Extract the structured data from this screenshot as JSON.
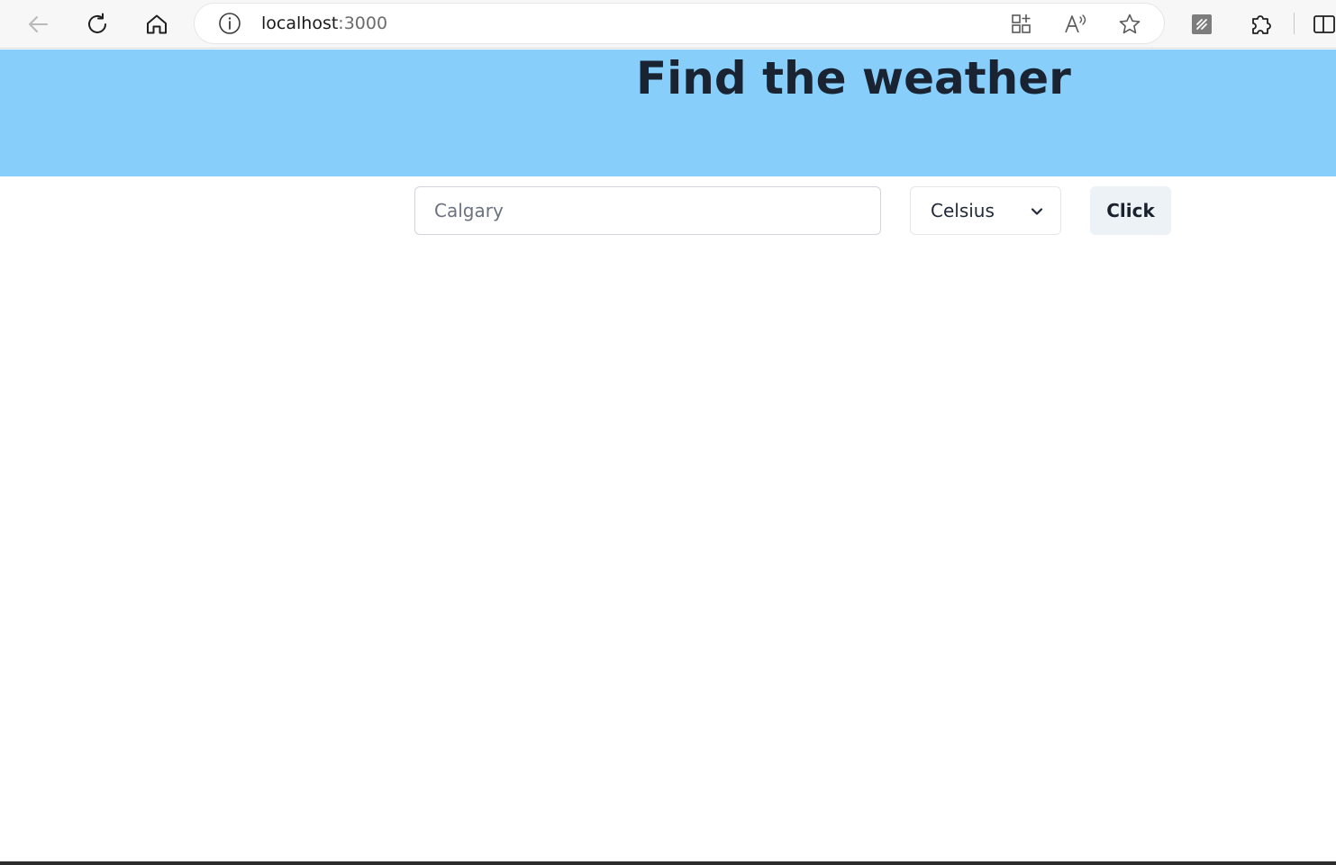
{
  "browser": {
    "url_host": "localhost",
    "url_port": ":3000",
    "toolbar_icons": {
      "back": "back-arrow-icon",
      "refresh": "refresh-icon",
      "home": "home-icon",
      "site_info": "info-icon",
      "app_available": "app-available-icon",
      "read_aloud": "read-aloud-icon",
      "favorite": "favorite-star-icon",
      "extension": "extension-app-icon",
      "extensions": "puzzle-icon",
      "split_screen": "split-screen-icon"
    }
  },
  "header": {
    "title": "Find the weather",
    "background_color": "#87cefa"
  },
  "search": {
    "city_placeholder": "Calgary",
    "city_value": "",
    "unit_selected": "Celsius",
    "submit_label": "Click"
  }
}
